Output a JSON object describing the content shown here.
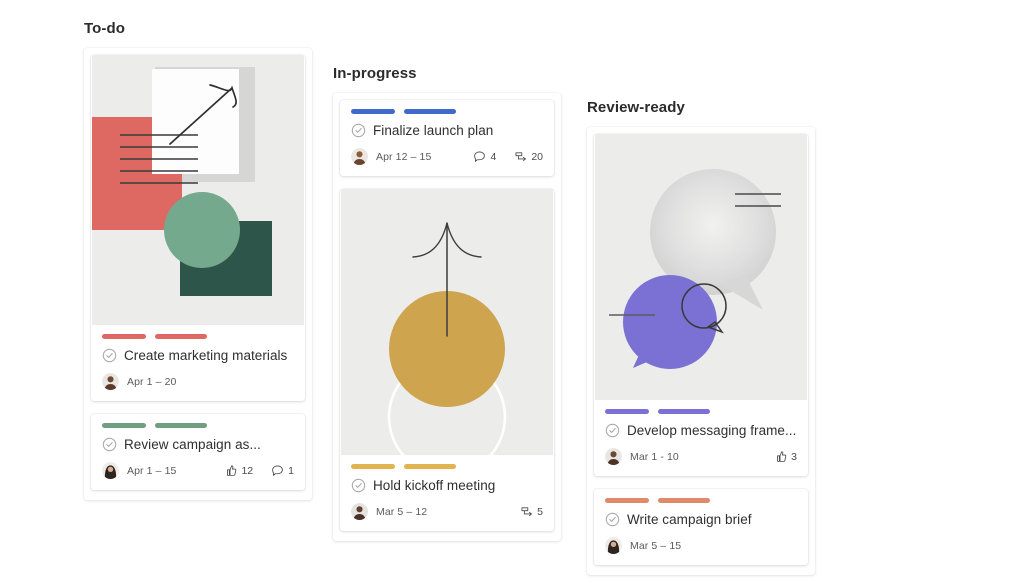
{
  "board": {
    "columns": [
      {
        "id": "todo",
        "title": "To-do",
        "cards": [
          {
            "id": "create-marketing-materials",
            "title": "Create marketing materials",
            "date": "Apr 1 – 20",
            "tag_color": "#dd6962",
            "has_art": true,
            "art": "abstract-red-green-arrow",
            "avatar": "avatar-man-dark",
            "check_icon": "check-circle-icon",
            "stats": []
          },
          {
            "id": "review-campaign-as",
            "title": "Review campaign as...",
            "date": "Apr 1 – 15",
            "tag_color": "#6f9e82",
            "has_art": false,
            "avatar": "avatar-woman-dark-hair",
            "check_icon": "check-circle-icon",
            "stats": [
              {
                "icon": "thumbs-up-icon",
                "count": "12"
              },
              {
                "icon": "comment-icon",
                "count": "1"
              }
            ]
          }
        ]
      },
      {
        "id": "in-progress",
        "title": "In-progress",
        "cards": [
          {
            "id": "finalize-launch-plan",
            "title": "Finalize launch plan",
            "date": "Apr 12 – 15",
            "tag_color": "#4169c9",
            "has_art": false,
            "avatar": "avatar-man-medium",
            "check_icon": "check-circle-icon",
            "stats": [
              {
                "icon": "comment-icon",
                "count": "4"
              },
              {
                "icon": "subtask-icon",
                "count": "20"
              }
            ]
          },
          {
            "id": "hold-kickoff-meeting",
            "title": "Hold kickoff meeting",
            "date": "Mar 5 – 12",
            "tag_color": "#e2b44f",
            "has_art": true,
            "art": "gold-circle-arrow",
            "avatar": "avatar-man-dark",
            "check_icon": "check-circle-icon",
            "stats": [
              {
                "icon": "subtask-icon",
                "count": "5"
              }
            ]
          }
        ]
      },
      {
        "id": "review-ready",
        "title": "Review-ready",
        "cards": [
          {
            "id": "develop-messaging-frame",
            "title": "Develop messaging frame...",
            "date": "Mar 1 - 10",
            "tag_color": "#7b71d4",
            "has_art": true,
            "art": "speech-bubbles",
            "avatar": "avatar-man-dark",
            "check_icon": "check-circle-icon",
            "stats": [
              {
                "icon": "thumbs-up-icon",
                "count": "3"
              }
            ]
          },
          {
            "id": "write-campaign-brief",
            "title": "Write campaign brief",
            "date": "Mar 5 – 15",
            "tag_color": "#e08a6a",
            "has_art": false,
            "avatar": "avatar-woman-dark-hair",
            "check_icon": "check-circle-icon",
            "stats": []
          }
        ]
      }
    ]
  },
  "palette": {
    "art_background": "#ececeb",
    "red": "#dd6962",
    "dark_green": "#2e5549",
    "light_green": "#74a98e",
    "gold": "#ceA44f",
    "purple": "#7b71d4",
    "ink": "#3a3a3a"
  }
}
